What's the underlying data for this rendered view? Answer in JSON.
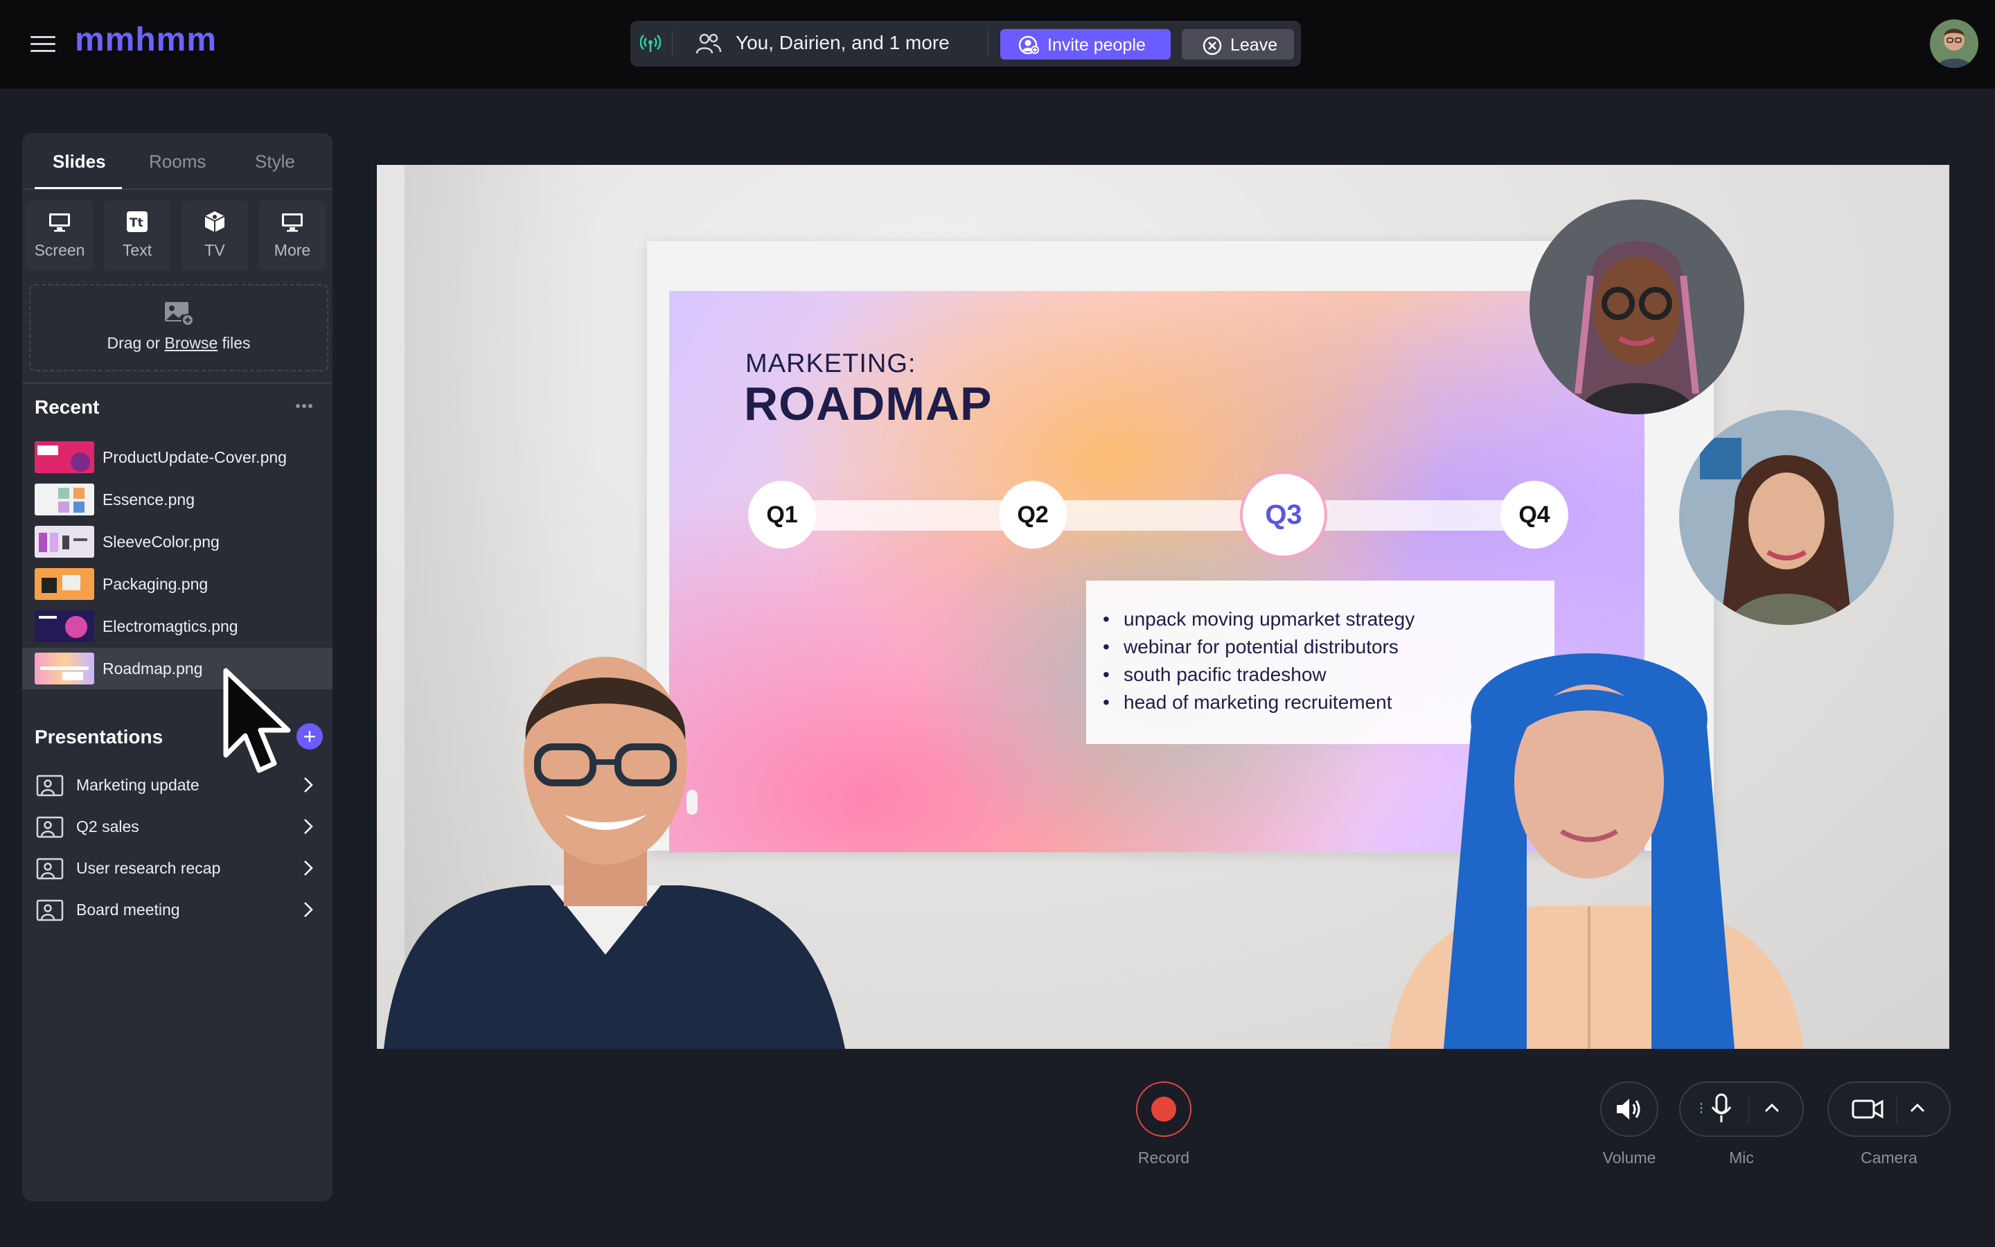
{
  "app": {
    "logo": "mmhmm"
  },
  "call": {
    "participants": "You, Dairien, and 1 more",
    "invite_label": "Invite people",
    "leave_label": "Leave"
  },
  "tabs": [
    "Slides",
    "Rooms",
    "Style"
  ],
  "tools": [
    {
      "label": "Screen",
      "icon": "monitor-icon"
    },
    {
      "label": "Text",
      "icon": "text-icon"
    },
    {
      "label": "TV",
      "icon": "cube-icon"
    },
    {
      "label": "More",
      "icon": "monitor-icon"
    }
  ],
  "dropzone": {
    "prefix": "Drag or ",
    "browse": "Browse",
    "suffix": " files"
  },
  "recent": {
    "title": "Recent",
    "items": [
      "ProductUpdate-Cover.png",
      "Essence.png",
      "SleeveColor.png",
      "Packaging.png",
      "Electromagtics.png",
      "Roadmap.png"
    ],
    "selected": "Roadmap.png"
  },
  "presentations": {
    "title": "Presentations",
    "items": [
      "Marketing update",
      "Q2 sales",
      "User research recap",
      "Board meeting"
    ]
  },
  "slide": {
    "kicker": "MARKETING:",
    "title": "ROADMAP",
    "quarters": [
      "Q1",
      "Q2",
      "Q3",
      "Q4"
    ],
    "active_quarter": "Q3",
    "bullets": [
      "unpack moving upmarket strategy",
      "webinar for potential distributors",
      "south pacific tradeshow",
      "head of marketing recruitement"
    ]
  },
  "controls": {
    "record": "Record",
    "volume": "Volume",
    "mic": "Mic",
    "camera": "Camera"
  },
  "colors": {
    "accent": "#6b5cff",
    "record": "#e8453a",
    "signal": "#2bd4a0",
    "bg": "#1a1d25",
    "panel": "#2a2c35"
  }
}
